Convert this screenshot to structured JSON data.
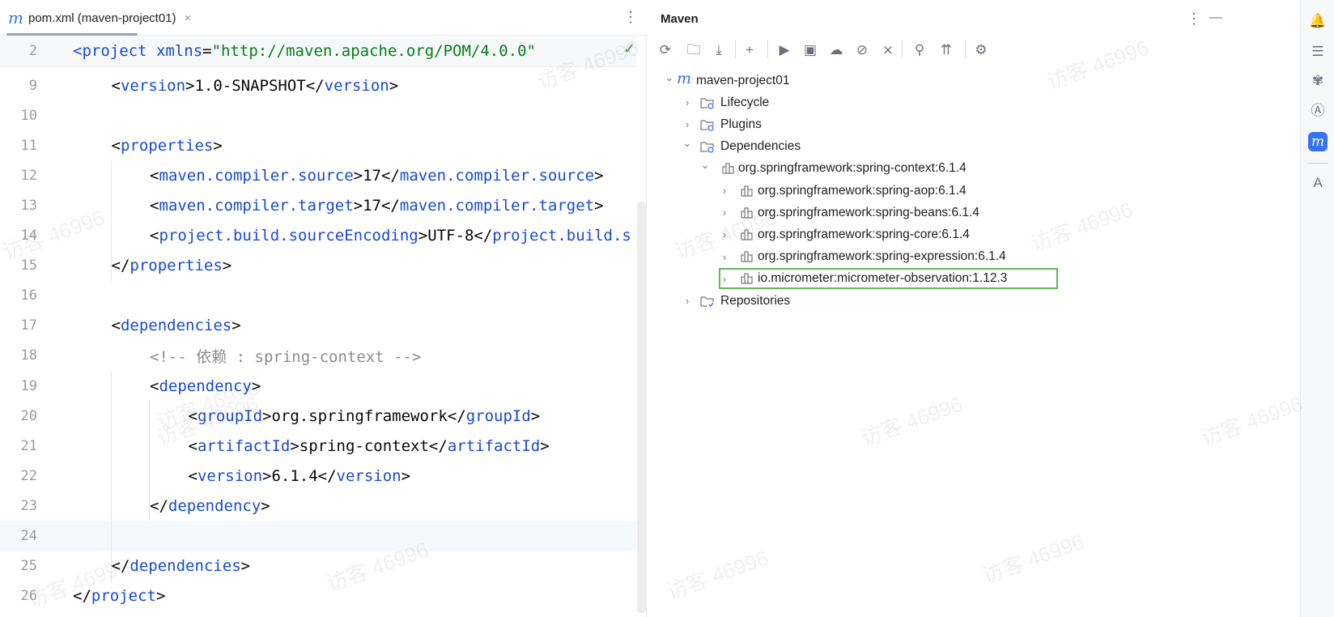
{
  "editor": {
    "tab": {
      "icon": "maven-m-icon",
      "label": "pom.xml (maven-project01)",
      "close": "×"
    },
    "menu": "⋮",
    "status_icon": "✓",
    "lines": [
      {
        "n": "2",
        "indent": 0,
        "seg": [
          [
            "tag",
            "<project "
          ],
          [
            "attr",
            "xmlns"
          ],
          [
            "txt",
            "="
          ],
          [
            "str",
            "\"http://maven.apache.org/POM/4.0.0\""
          ]
        ]
      },
      {
        "n": "9",
        "indent": 1,
        "seg": [
          [
            "txt",
            "<"
          ],
          [
            "tag",
            "version"
          ],
          [
            "txt",
            ">1.0-SNAPSHOT</"
          ],
          [
            "tag",
            "version"
          ],
          [
            "txt",
            ">"
          ]
        ]
      },
      {
        "n": "10",
        "indent": 0,
        "seg": []
      },
      {
        "n": "11",
        "indent": 1,
        "seg": [
          [
            "txt",
            "<"
          ],
          [
            "tag",
            "properties"
          ],
          [
            "txt",
            ">"
          ]
        ]
      },
      {
        "n": "12",
        "indent": 2,
        "seg": [
          [
            "txt",
            "<"
          ],
          [
            "tag",
            "maven.compiler.source"
          ],
          [
            "txt",
            ">17</"
          ],
          [
            "tag",
            "maven.compiler.source"
          ],
          [
            "txt",
            ">"
          ]
        ]
      },
      {
        "n": "13",
        "indent": 2,
        "seg": [
          [
            "txt",
            "<"
          ],
          [
            "tag",
            "maven.compiler.target"
          ],
          [
            "txt",
            ">17</"
          ],
          [
            "tag",
            "maven.compiler.target"
          ],
          [
            "txt",
            ">"
          ]
        ]
      },
      {
        "n": "14",
        "indent": 2,
        "seg": [
          [
            "txt",
            "<"
          ],
          [
            "tag",
            "project.build.sourceEncoding"
          ],
          [
            "txt",
            ">UTF-8</"
          ],
          [
            "tag",
            "project.build.s"
          ]
        ]
      },
      {
        "n": "15",
        "indent": 1,
        "seg": [
          [
            "txt",
            "</"
          ],
          [
            "tag",
            "properties"
          ],
          [
            "txt",
            ">"
          ]
        ]
      },
      {
        "n": "16",
        "indent": 0,
        "seg": []
      },
      {
        "n": "17",
        "indent": 1,
        "seg": [
          [
            "txt",
            "<"
          ],
          [
            "tag",
            "dependencies"
          ],
          [
            "txt",
            ">"
          ]
        ]
      },
      {
        "n": "18",
        "indent": 2,
        "seg": [
          [
            "cmt",
            "<!-- 依赖 : spring-context -->"
          ]
        ]
      },
      {
        "n": "19",
        "indent": 2,
        "seg": [
          [
            "txt",
            "<"
          ],
          [
            "tag",
            "dependency"
          ],
          [
            "txt",
            ">"
          ]
        ]
      },
      {
        "n": "20",
        "indent": 3,
        "seg": [
          [
            "txt",
            "<"
          ],
          [
            "tag",
            "groupId"
          ],
          [
            "txt",
            ">org.springframework</"
          ],
          [
            "tag",
            "groupId"
          ],
          [
            "txt",
            ">"
          ]
        ]
      },
      {
        "n": "21",
        "indent": 3,
        "seg": [
          [
            "txt",
            "<"
          ],
          [
            "tag",
            "artifactId"
          ],
          [
            "txt",
            ">spring-context</"
          ],
          [
            "tag",
            "artifactId"
          ],
          [
            "txt",
            ">"
          ]
        ]
      },
      {
        "n": "22",
        "indent": 3,
        "seg": [
          [
            "txt",
            "<"
          ],
          [
            "tag",
            "version"
          ],
          [
            "txt",
            ">6.1.4</"
          ],
          [
            "tag",
            "version"
          ],
          [
            "txt",
            ">"
          ]
        ]
      },
      {
        "n": "23",
        "indent": 2,
        "seg": [
          [
            "txt",
            "</"
          ],
          [
            "tag",
            "dependency"
          ],
          [
            "txt",
            ">"
          ]
        ]
      },
      {
        "n": "24",
        "indent": 0,
        "seg": [],
        "current": true
      },
      {
        "n": "25",
        "indent": 1,
        "seg": [
          [
            "txt",
            "</"
          ],
          [
            "tag",
            "dependencies"
          ],
          [
            "txt",
            ">"
          ]
        ]
      },
      {
        "n": "26",
        "indent": 0,
        "seg": [
          [
            "txt",
            "</"
          ],
          [
            "tag",
            "project"
          ],
          [
            "txt",
            ">"
          ]
        ]
      }
    ]
  },
  "maven": {
    "title": "Maven",
    "menu": "⋮",
    "minimize": "—",
    "toolbar": [
      {
        "name": "reload-icon",
        "glyph": "⟳"
      },
      {
        "name": "reload-folder-icon",
        "glyph": "🗀"
      },
      {
        "name": "download-icon",
        "glyph": "⤓"
      },
      {
        "name": "add-icon",
        "glyph": "+"
      },
      {
        "name": "run-icon",
        "glyph": "▶"
      },
      {
        "name": "execute-goal-icon",
        "glyph": "▣"
      },
      {
        "name": "offline-icon",
        "glyph": "☁"
      },
      {
        "name": "skip-tests-icon",
        "glyph": "⊘"
      },
      {
        "name": "collapse-icon",
        "glyph": "⨯"
      },
      {
        "name": "analyze-dependencies-icon",
        "glyph": "⚲"
      },
      {
        "name": "show-dependencies-icon",
        "glyph": "⇈"
      },
      {
        "name": "settings-icon",
        "glyph": "⚙"
      }
    ],
    "tree": [
      {
        "label": "maven-project01",
        "level": 0,
        "expanded": true,
        "icon": "maven-m-icon"
      },
      {
        "label": "Lifecycle",
        "level": 1,
        "expanded": false,
        "icon": "folder-gear-icon"
      },
      {
        "label": "Plugins",
        "level": 1,
        "expanded": false,
        "icon": "folder-gear-icon"
      },
      {
        "label": "Dependencies",
        "level": 1,
        "expanded": true,
        "icon": "folder-library-icon"
      },
      {
        "label": "org.springframework:spring-context:6.1.4",
        "level": 2,
        "expanded": true,
        "icon": "library-icon"
      },
      {
        "label": "org.springframework:spring-aop:6.1.4",
        "level": 3,
        "expanded": false,
        "icon": "library-icon"
      },
      {
        "label": "org.springframework:spring-beans:6.1.4",
        "level": 3,
        "expanded": false,
        "icon": "library-icon"
      },
      {
        "label": "org.springframework:spring-core:6.1.4",
        "level": 3,
        "expanded": false,
        "icon": "library-icon"
      },
      {
        "label": "org.springframework:spring-expression:6.1.4",
        "level": 3,
        "expanded": false,
        "icon": "library-icon"
      },
      {
        "label": "io.micrometer:micrometer-observation:1.12.3",
        "level": 3,
        "expanded": false,
        "icon": "library-icon",
        "highlighted": true
      },
      {
        "label": "Repositories",
        "level": 1,
        "expanded": false,
        "icon": "folder-check-icon"
      }
    ],
    "highlight_color": "#5fb85f"
  },
  "right_strip": [
    {
      "name": "notifications-icon",
      "glyph": "🔔"
    },
    {
      "name": "database-icon",
      "glyph": "☰"
    },
    {
      "name": "plugin-icon",
      "glyph": "✾"
    },
    {
      "name": "ai-assistant-icon",
      "glyph": "Ⓐ"
    },
    {
      "name": "maven-icon",
      "glyph": "m",
      "active": true
    },
    {
      "name": "bookmarks-icon",
      "glyph": "A"
    }
  ],
  "watermark": "访客 46996",
  "colors": {
    "accent": "#3574f0",
    "tag": "#174ad4",
    "string": "#067d17",
    "comment": "#8c8c8c"
  }
}
